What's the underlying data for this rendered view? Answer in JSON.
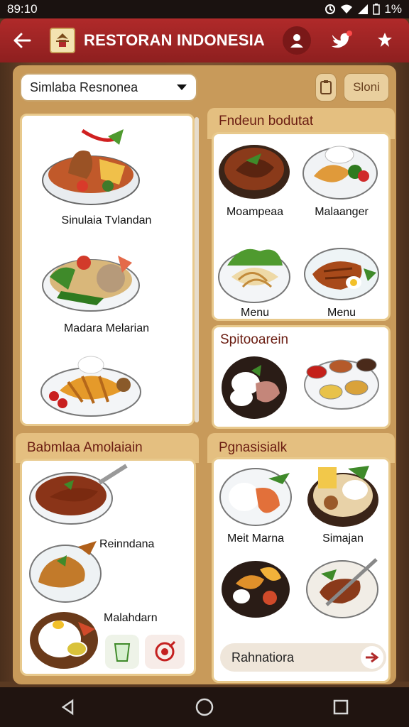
{
  "status": {
    "time": "89:10",
    "battery": "1%"
  },
  "app_bar": {
    "title": "RESTORAN INDONESIA"
  },
  "toolbar": {
    "selector_value": "Simlaba Resnonea",
    "action_label": "Sloni"
  },
  "left_top": {
    "items": [
      {
        "label": "Sinulaia Tvlandan",
        "icon": "chicken-curry-bowl"
      },
      {
        "label": "Madara Melarian",
        "icon": "rice-salad-plate"
      },
      {
        "label": "",
        "icon": "banana-fritter-plate"
      }
    ]
  },
  "right_top": {
    "title": "Fndeun bodutat",
    "items": [
      {
        "label": "Moampeaa",
        "icon": "braised-meat-bowl"
      },
      {
        "label": "Malaanger",
        "icon": "satay-salad-plate"
      },
      {
        "label": "Menu",
        "icon": "noodle-plate"
      },
      {
        "label": "Menu",
        "icon": "grilled-fish-plate"
      }
    ]
  },
  "right_mid": {
    "title": "Spitooarein",
    "items": [
      {
        "icon": "rice-beef-plate"
      },
      {
        "icon": "condiment-tray"
      }
    ]
  },
  "left_bottom": {
    "title": "Babmlaa Amolaiain",
    "items": [
      {
        "label": "",
        "icon": "sausage-bowl"
      },
      {
        "label": "Reinndana",
        "icon": "roast-chicken-plate"
      },
      {
        "label": "Malahdarn",
        "icon": "rice-egg-plate"
      }
    ]
  },
  "right_bottom": {
    "title": "Pgnasisialk",
    "items": [
      {
        "label": "Meit Marna",
        "icon": "rice-shrimp-plate"
      },
      {
        "label": "Simajan",
        "icon": "mixed-rice-bowl"
      },
      {
        "label": "",
        "icon": "fried-snacks-bowl"
      },
      {
        "label": "",
        "icon": "steak-knife-plate"
      }
    ],
    "pill_label": "Rahnatiora"
  },
  "colors": {
    "accent": "#8e1f1f",
    "panel": "#c89a5a",
    "header_band": "#e4bf80"
  }
}
